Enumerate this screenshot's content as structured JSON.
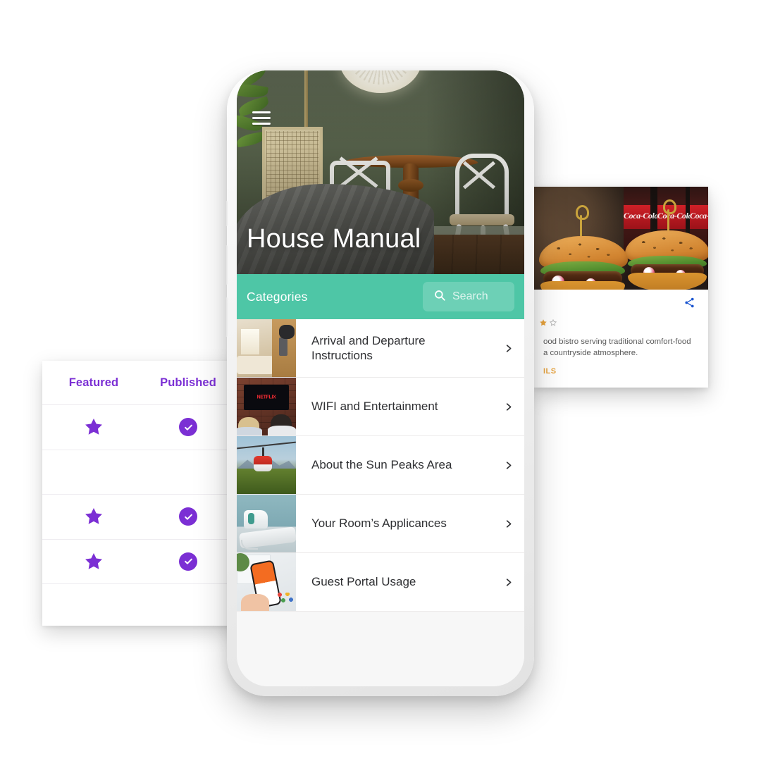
{
  "table_panel": {
    "columns": [
      "Featured",
      "Published"
    ],
    "accent_color": "#7b2fd4",
    "rows": [
      {
        "featured": true,
        "published": true,
        "featured_icon": "star-icon",
        "published_icon": "check-circle-icon"
      },
      {
        "featured": false,
        "published": false,
        "featured_icon": "",
        "published_icon": ""
      },
      {
        "featured": true,
        "published": true,
        "featured_icon": "star-icon",
        "published_icon": "check-circle-icon"
      },
      {
        "featured": true,
        "published": true,
        "featured_icon": "star-icon",
        "published_icon": "check-circle-icon"
      },
      {
        "featured": false,
        "published": false,
        "featured_icon": "",
        "published_icon": ""
      }
    ]
  },
  "restaurant_card": {
    "photo_alt": "two burgers with coca-cola bottles",
    "share_icon": "share-icon",
    "rating": {
      "filled": 1,
      "empty": 1,
      "filled_color": "#e8a33d",
      "empty_color": "#b8b8b8"
    },
    "description_line1": "ood bistro serving traditional comfort-food",
    "description_line2": "a countryside atmosphere.",
    "cta_label": "ILS",
    "cta_color": "#e8a33d",
    "share_color": "#1a55d0"
  },
  "phone": {
    "hero": {
      "menu_icon": "hamburger-menu-icon",
      "title": "House Manual",
      "image_alt": "green room with wooden table white chairs and bed"
    },
    "categories_bar": {
      "title": "Categories",
      "teal_color": "#4ec6a6",
      "search": {
        "icon": "search-icon",
        "placeholder": "Search",
        "value": ""
      }
    },
    "categories": [
      {
        "label": "Arrival and Departure Instructions",
        "thumb": "hotel-room-door",
        "chevron": "chevron-right-icon"
      },
      {
        "label": "WIFI and Entertainment",
        "thumb": "netflix-tv",
        "chevron": "chevron-right-icon"
      },
      {
        "label": "About the Sun Peaks Area",
        "thumb": "gondola-mountain",
        "chevron": "chevron-right-icon"
      },
      {
        "label": "Your Room’s Applicances",
        "thumb": "iron-board",
        "chevron": "chevron-right-icon"
      },
      {
        "label": "Guest Portal Usage",
        "thumb": "phone-app",
        "chevron": "chevron-right-icon"
      }
    ]
  }
}
